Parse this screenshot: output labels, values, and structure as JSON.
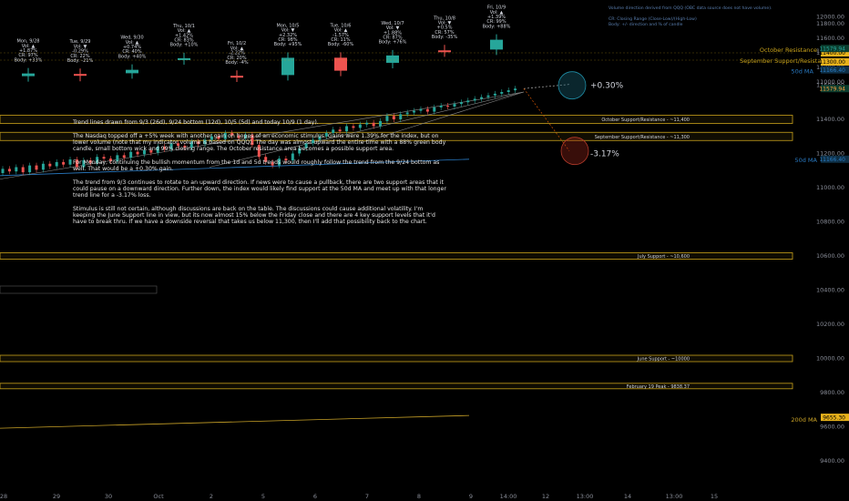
{
  "legend_note": {
    "line1": "Volume direction derived from QQQ (OBC data source does not have volume).",
    "line2": "CR: Closing Range (Close-Low)/(High-Low)",
    "line3": "Body: +/- direction and % of candle"
  },
  "analysis": {
    "p1": "Trend lines drawn from 9/3 (26d), 9/24 bottom (12d), 10/5 (5d) and today 10/9 (1 day).",
    "p2": "The Nasdaq topped off a +5% week with another gain on hopes of an economic stimulus. Gains were 1.39% for the index, but on lower volume (note that my indicator volume is based on QQQ). The day was almost upward the entire time with a 88% green body candle, small bottom wick and 99% closing range. The October resistance area becomes a possible support area.",
    "p3": "For Monday, continuing the bullish momentum from the 1d and 5d trends would roughly follow the trend from the 9/24 bottom as well. That would be a +0.30% gain.",
    "p4": "The trend from 9/3 continues to rotate to an upward direction. If news were to cause a pullback, there are two support areas that it could pause on a downward direction. Further down, the index would likely find support at the 50d MA and meet up with that longer trend line for a -3.17% loss.",
    "p5": "Stimulus is still not certain, although discussions are back on the table. The discussions could cause additional volatility. I'm keeping the June Support line in view, but its now almost 15% below the Friday close and there are 4 key support levels that it'd have to break thru. If we have a downside reversal that takes us below 11,300, then I'll add that possibility back to the chart."
  },
  "projections": {
    "up": "+0.30%",
    "down": "-3.17%"
  },
  "chart_data": {
    "type": "candlestick",
    "price_axis": {
      "ticks": [
        11800,
        11600,
        11400,
        11200,
        11000,
        12600,
        12400,
        12200,
        12000,
        11800,
        11600,
        11400,
        11200,
        11000,
        10800,
        10600,
        10400,
        10200,
        10000,
        9800,
        9600,
        9400
      ],
      "tick_labels": [
        "11800.00",
        "11600.00",
        "11400.00",
        "11200.00",
        "11000.00",
        "12600.00",
        "12400.00",
        "12200.00",
        "12000.00",
        "11800.00",
        "11600.00",
        "11400.00",
        "11200.00",
        "11000.00",
        "10800.00",
        "10600.00",
        "10400.00",
        "10200.00",
        "10000.00",
        "9800.00",
        "9600.00",
        "9400.00"
      ]
    },
    "time_axis": {
      "labels": [
        "28",
        "29",
        "30",
        "Oct",
        "2",
        "5",
        "6",
        "7",
        "8",
        "9",
        "14:00",
        "12",
        "13:00",
        "14",
        "13:00",
        "15"
      ]
    },
    "price_tags": {
      "top_close": "11579.94",
      "top_50d": "11166.40",
      "top_sep": "11300.00",
      "top_oct": "11400.00",
      "main_close": "11579.94",
      "main_50d": "11166.40",
      "main_200d": "9655.30"
    },
    "daily_labels": [
      {
        "date": "Mon, 9/28",
        "vol": "Vol: ▲",
        "chg": "+1.87%",
        "cr": "CR: 97%",
        "body": "Body: +33%",
        "close": 11117,
        "open": 11080,
        "color": "#26a69a"
      },
      {
        "date": "Tue, 9/29",
        "vol": "Vol: ▼",
        "chg": "-0.29%",
        "cr": "CR: 22%",
        "body": "Body: -21%",
        "close": 11085,
        "open": 11110,
        "color": "#ef5350"
      },
      {
        "date": "Wed, 9/30",
        "vol": "Vol: ▲",
        "chg": "+0.74%",
        "cr": "CR: 40%",
        "body": "Body: +40%",
        "close": 11167,
        "open": 11120,
        "color": "#26a69a"
      },
      {
        "date": "Thu, 10/1",
        "vol": "Vol: ▲",
        "chg": "+1.42%",
        "cr": "CR: 83%",
        "body": "Body: +10%",
        "close": 11326,
        "open": 11312,
        "color": "#26a69a"
      },
      {
        "date": "Fri, 10/2",
        "vol": "Vol: ▲",
        "chg": "-2.22%",
        "cr": "CR: 20%",
        "body": "Body: -4%",
        "close": 11075,
        "open": 11085,
        "color": "#ef5350"
      },
      {
        "date": "Mon, 10/5",
        "vol": "Vol: ▼",
        "chg": "+2.32%",
        "cr": "CR: 98%",
        "body": "Body: +95%",
        "close": 11332,
        "open": 11095,
        "color": "#26a69a"
      },
      {
        "date": "Tue, 10/6",
        "vol": "Vol: ▲",
        "chg": "-1.57%",
        "cr": "CR: 11%",
        "body": "Body: -60%",
        "close": 11155,
        "open": 11333,
        "color": "#ef5350"
      },
      {
        "date": "Wed, 10/7",
        "vol": "Vol: ▼",
        "chg": "+1.88%",
        "cr": "CR: 87%",
        "body": "Body: +76%",
        "close": 11364,
        "open": 11263,
        "color": "#26a69a"
      },
      {
        "date": "Thu, 10/8",
        "vol": "Vol: ▼",
        "chg": "+0.5%",
        "cr": "CR: 57%",
        "body": "Body: -35%",
        "close": 11420,
        "open": 11434,
        "color": "#ef5350"
      },
      {
        "date": "Fri, 10/9",
        "vol": "Vol: ▲",
        "chg": "+1.39%",
        "cr": "CR: 99%",
        "body": "Body: +88%",
        "close": 11580,
        "open": 11445,
        "color": "#26a69a"
      }
    ],
    "levels": [
      {
        "name": "October Resistance",
        "main_label": "October Support/Resistance - ~11,400",
        "value": 11400,
        "color": "#c8a21b"
      },
      {
        "name": "September Support/Resistance",
        "main_label": "September Support/Resistance - ~11,300",
        "value": 11300,
        "color": "#c8a21b"
      },
      {
        "name": "July Support",
        "main_label": "July Support - ~10,600",
        "value": 10600,
        "color": "#c8a21b"
      },
      {
        "name": "June Support",
        "main_label": "June Support - ~10000",
        "value": 10000,
        "color": "#c8a21b"
      },
      {
        "name": "February 19 Peak",
        "main_label": "February 19 Peak - 9838.37",
        "value": 9838.37,
        "color": "#c8a21b"
      }
    ],
    "moving_averages": [
      {
        "name": "50d MA",
        "value": 11166.4,
        "color": "#2a7bc4"
      },
      {
        "name": "200d MA",
        "value": 9655.3,
        "color": "#c9a227"
      }
    ],
    "top_level_labels": {
      "oct": "October Resistance",
      "sep": "September Support/Resistance",
      "ma50": "50d MA"
    },
    "ma200_label": "200d MA",
    "intraday": [
      11085,
      11110,
      11095,
      11120,
      11090,
      11130,
      11105,
      11140,
      11125,
      11150,
      11135,
      11165,
      11120,
      11160,
      11145,
      11180,
      11170,
      11155,
      11190,
      11175,
      11210,
      11195,
      11220,
      11205,
      11240,
      11225,
      11260,
      11245,
      11235,
      11270,
      11255,
      11280,
      11300,
      11285,
      11320,
      11305,
      11290,
      11310,
      11250,
      11180,
      11150,
      11130,
      11170,
      11160,
      11200,
      11230,
      11260,
      11280,
      11300,
      11320,
      11340,
      11330,
      11360,
      11350,
      11370,
      11380,
      11360,
      11390,
      11420,
      11400,
      11430,
      11440,
      11450,
      11460,
      11445,
      11470,
      11480,
      11475,
      11490,
      11500,
      11510,
      11520,
      11530,
      11540,
      11550,
      11560,
      11570,
      11580
    ]
  }
}
